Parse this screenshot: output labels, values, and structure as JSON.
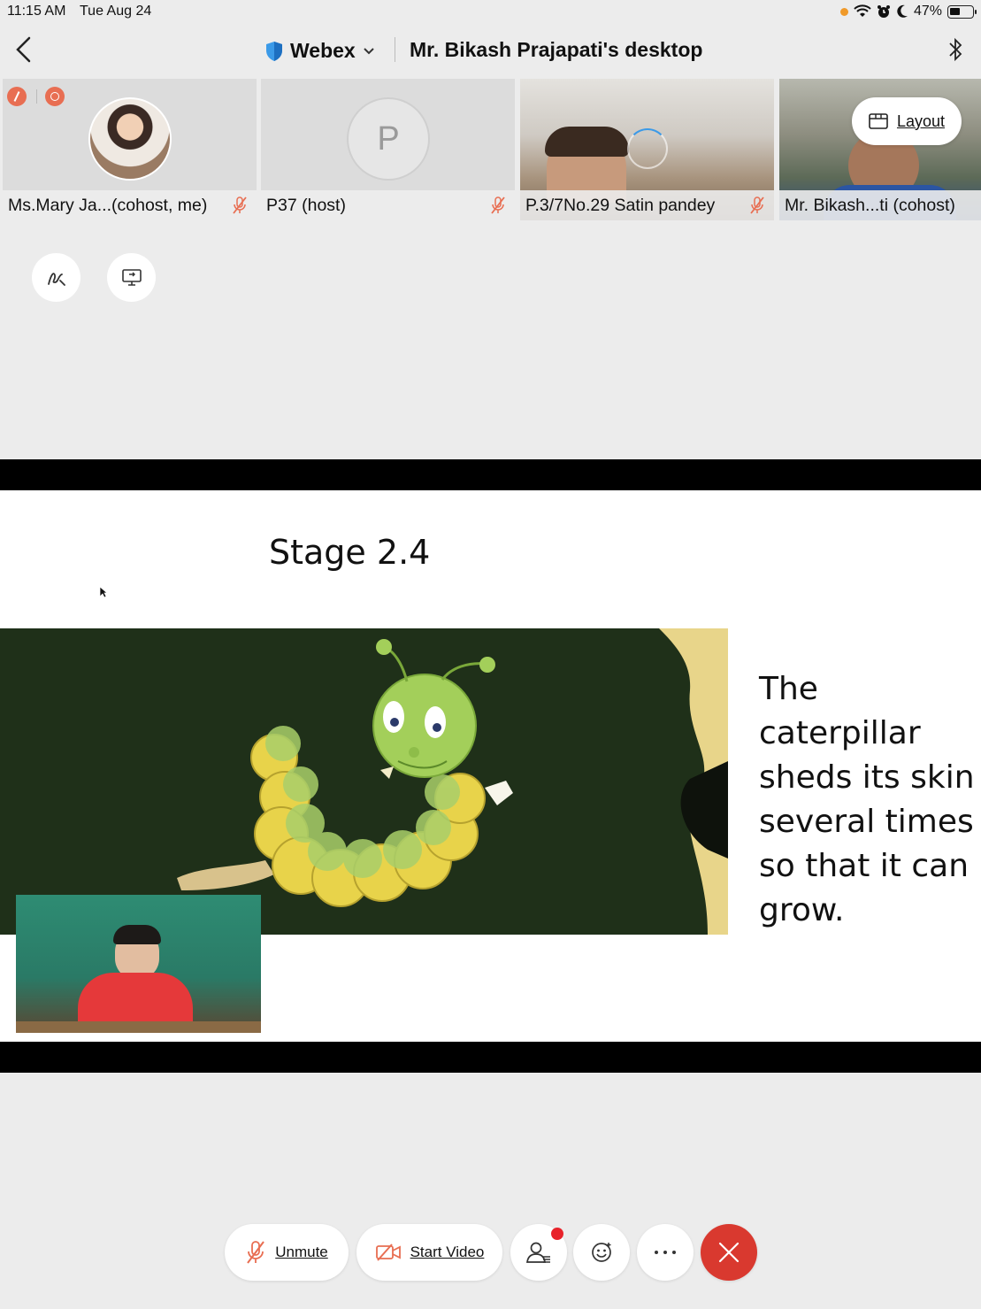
{
  "status_bar": {
    "time": "11:15 AM",
    "date": "Tue Aug 24",
    "battery_percent": "47%",
    "battery_level": 0.47,
    "icons": [
      "orange-dot-icon",
      "wifi-icon",
      "alarm-icon",
      "moon-icon",
      "battery-icon"
    ]
  },
  "header": {
    "app_name": "Webex",
    "title": "Mr. Bikash Prajapati's desktop"
  },
  "participants": [
    {
      "name": "Ms.Mary Ja...(cohost, me)",
      "muted": true
    },
    {
      "name": "P37 (host)",
      "initial": "P",
      "muted": true
    },
    {
      "name": "P.3/7No.29 Satin pandey",
      "muted": true
    },
    {
      "name": "Mr. Bikash...ti (cohost)",
      "muted": false
    }
  ],
  "layout_button": {
    "label": "Layout"
  },
  "slide": {
    "title": "Stage 2.4",
    "body": "The caterpillar sheds its skin several times so that it can grow."
  },
  "controls": {
    "unmute_label": "Unmute",
    "start_video_label": "Start Video"
  },
  "colors": {
    "accent_red": "#d9392f",
    "mute_red": "#e86e52",
    "webex_blue": "#3b9ae8",
    "slide_bg_dark": "#1f3019"
  }
}
